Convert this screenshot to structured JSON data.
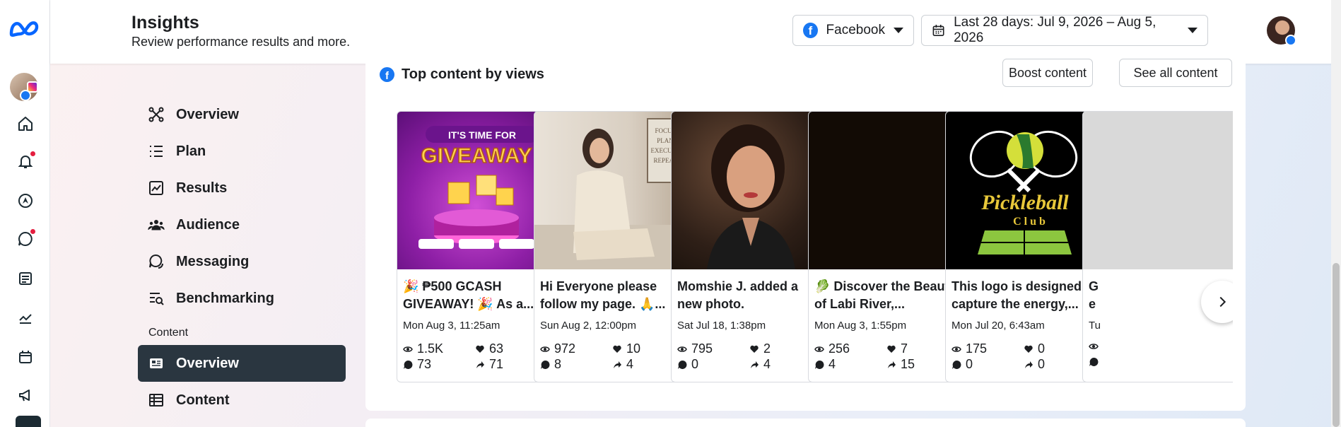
{
  "header": {
    "title": "Insights",
    "subtitle": "Review performance results and more.",
    "platform_label": "Facebook",
    "date_range_label": "Last 28 days: Jul 9, 2026 – Aug 5, 2026"
  },
  "rail": {
    "icons": [
      "meta-logo",
      "account-icon",
      "home-icon",
      "notifications-icon",
      "planner-icon",
      "inbox-icon",
      "content-icon",
      "insights-icon",
      "calendar-icon",
      "ads-icon"
    ]
  },
  "nav": {
    "items": [
      {
        "label": "Overview",
        "icon": "overview-icon"
      },
      {
        "label": "Plan",
        "icon": "plan-icon"
      },
      {
        "label": "Results",
        "icon": "results-icon"
      },
      {
        "label": "Audience",
        "icon": "audience-icon"
      },
      {
        "label": "Messaging",
        "icon": "messaging-icon"
      },
      {
        "label": "Benchmarking",
        "icon": "benchmarking-icon"
      }
    ],
    "section_label": "Content",
    "content_items": [
      {
        "label": "Overview",
        "icon": "content-overview-icon",
        "active": true
      },
      {
        "label": "Content",
        "icon": "table-icon",
        "active": false
      }
    ]
  },
  "card": {
    "title": "Top content by views",
    "boost_label": "Boost content",
    "see_all_label": "See all content"
  },
  "posts": [
    {
      "text": "🎉 ₱500 GCASH GIVEAWAY! 🎉 As a...",
      "date": "Mon Aug 3, 11:25am",
      "views": "1.5K",
      "likes": "63",
      "comments": "73",
      "shares": "71",
      "thumb_text_1": "IT'S TIME FOR",
      "thumb_text_2": "GIVEAWAY",
      "type": "photo"
    },
    {
      "text": "Hi Everyone please follow my page. 🙏...",
      "date": "Sun Aug 2, 12:00pm",
      "views": "972",
      "likes": "10",
      "comments": "8",
      "shares": "4",
      "thumb_lines": [
        "FOCUS",
        "PLAN",
        "EXECUTE",
        "REPEAT"
      ],
      "type": "photo"
    },
    {
      "text": "Momshie J. added a new photo.",
      "date": "Sat Jul 18, 1:38pm",
      "views": "795",
      "likes": "2",
      "comments": "0",
      "shares": "4",
      "type": "photo"
    },
    {
      "text": "🥬 Discover the Beauty of Labi River,...",
      "date": "Mon Aug 3, 1:55pm",
      "views": "256",
      "likes": "7",
      "comments": "4",
      "shares": "15",
      "type": "reel"
    },
    {
      "text": "This logo is designed to capture the energy,...",
      "date": "Mon Jul 20, 6:43am",
      "views": "175",
      "likes": "0",
      "comments": "0",
      "shares": "0",
      "thumb_text_1": "Pickleball",
      "thumb_text_2": "C l u b",
      "type": "photo"
    },
    {
      "text": "G e",
      "date": "Tu",
      "type": "photo"
    }
  ]
}
